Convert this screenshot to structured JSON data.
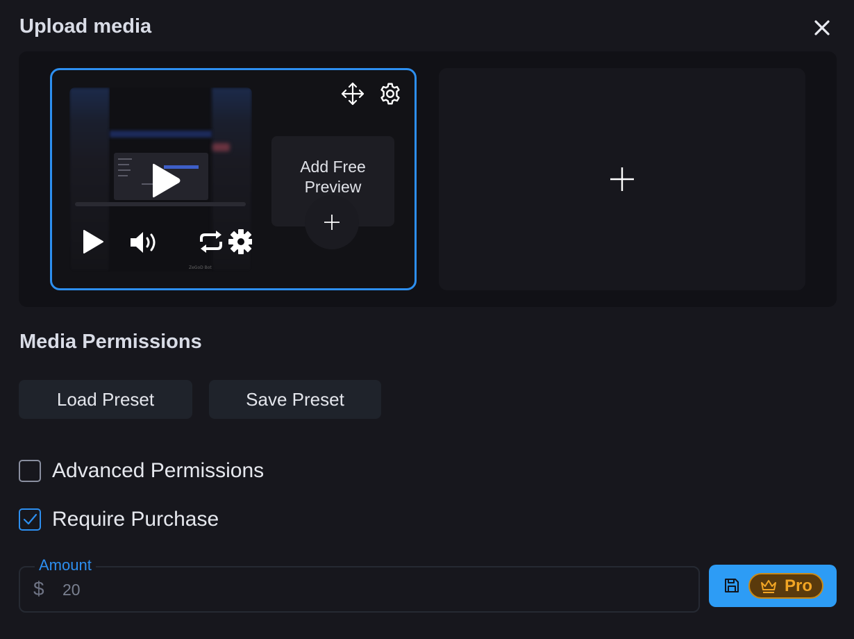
{
  "dialog": {
    "title": "Upload media",
    "close_icon": "close-icon"
  },
  "media": {
    "video_thumbnail_caption": "ZeGoD Bot",
    "add_free_preview_label": "Add Free Preview",
    "icons": [
      "move-icon",
      "gear-icon",
      "play-icon",
      "volume-icon",
      "repeat-icon",
      "plus-icon"
    ]
  },
  "permissions": {
    "title": "Media Permissions",
    "load_preset_label": "Load Preset",
    "save_preset_label": "Save Preset",
    "advanced_label": "Advanced Permissions",
    "advanced_checked": false,
    "require_purchase_label": "Require Purchase",
    "require_purchase_checked": true
  },
  "amount": {
    "label": "Amount",
    "currency_symbol": "$",
    "value": "20"
  },
  "save_button": {
    "pro_label": "Pro"
  },
  "colors": {
    "background": "#17171d",
    "accent": "#2d8ff0",
    "save_button": "#2d9cf5",
    "pro_text": "#f2a524"
  }
}
